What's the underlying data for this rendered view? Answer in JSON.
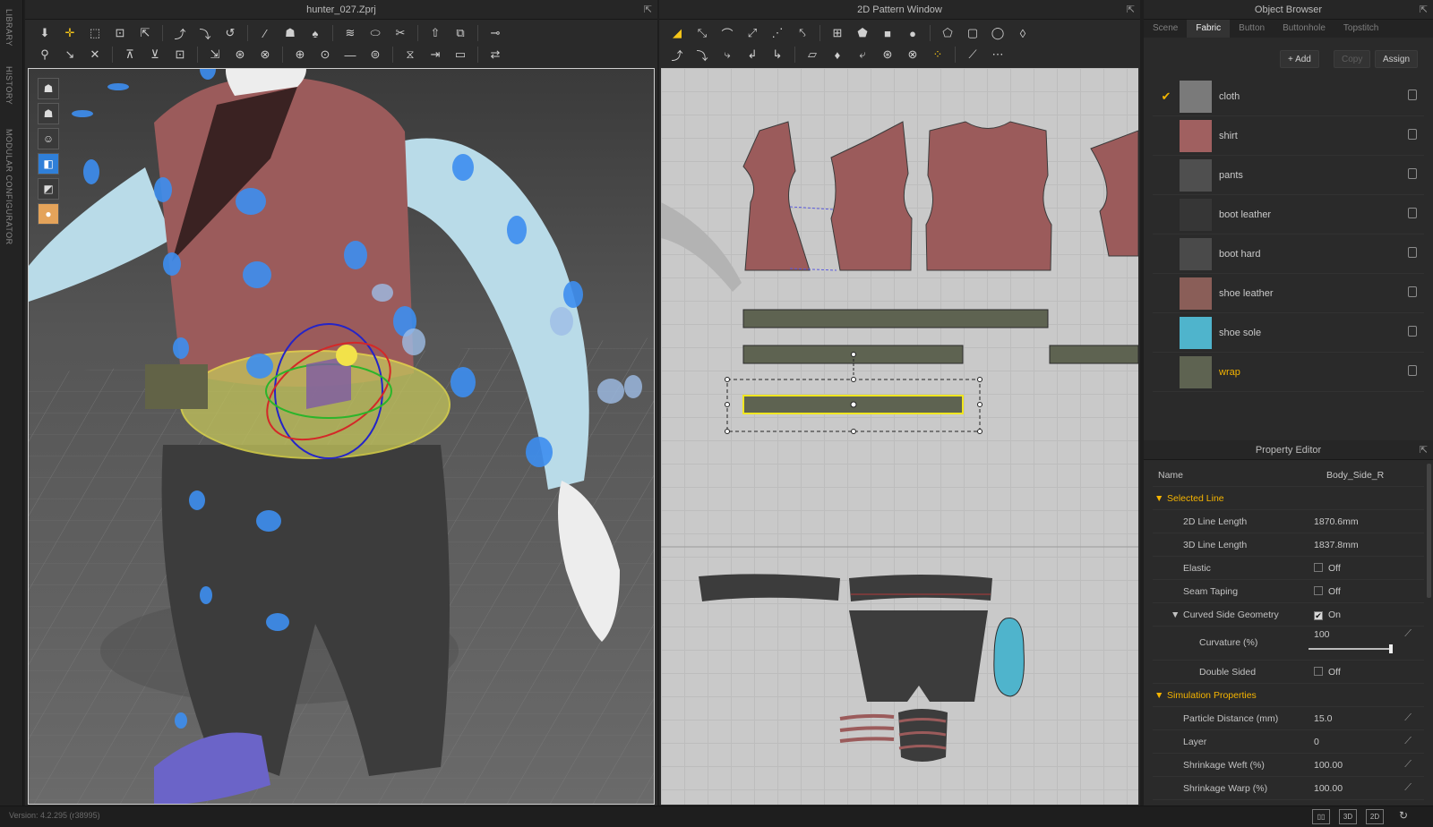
{
  "side_tabs": [
    "LIBRARY",
    "HISTORY",
    "MODULAR CONFIGURATOR"
  ],
  "viewport3d": {
    "title": "hunter_027.Zprj"
  },
  "pattern": {
    "title": "2D Pattern Window"
  },
  "object_browser": {
    "title": "Object Browser",
    "tabs": [
      "Scene",
      "Fabric",
      "Button",
      "Buttonhole",
      "Topstitch"
    ],
    "active_tab": "Fabric",
    "buttons": {
      "add": "+ Add",
      "copy": "Copy",
      "assign": "Assign"
    },
    "fabrics": [
      {
        "name": "cloth",
        "color": "#7a7a7a",
        "checked": true
      },
      {
        "name": "shirt",
        "color": "#a06060"
      },
      {
        "name": "pants",
        "color": "#4f4f4f"
      },
      {
        "name": "boot leather",
        "color": "#363636"
      },
      {
        "name": "boot hard",
        "color": "#4a4a4a"
      },
      {
        "name": "shoe leather",
        "color": "#8a5e58"
      },
      {
        "name": "shoe sole",
        "color": "#4fb4cc"
      },
      {
        "name": "wrap",
        "color": "#5e6351",
        "highlight": true
      }
    ]
  },
  "property_editor": {
    "title": "Property Editor",
    "name_label": "Name",
    "name_value": "Body_Side_R",
    "selected_line": "Selected Line",
    "line_2d_label": "2D Line Length",
    "line_2d_value": "1870.6mm",
    "line_3d_label": "3D Line Length",
    "line_3d_value": "1837.8mm",
    "elastic_label": "Elastic",
    "elastic_value": "Off",
    "seam_label": "Seam Taping",
    "seam_value": "Off",
    "curved_label": "Curved Side Geometry",
    "curved_value": "On",
    "curvature_label": "Curvature (%)",
    "curvature_value": "100",
    "double_label": "Double Sided",
    "double_value": "Off",
    "sim_props": "Simulation Properties",
    "particle_label": "Particle Distance (mm)",
    "particle_value": "15.0",
    "layer_label": "Layer",
    "layer_value": "0",
    "weft_label": "Shrinkage Weft (%)",
    "weft_value": "100.00",
    "warp_label": "Shrinkage Warp (%)",
    "warp_value": "100.00"
  },
  "status": {
    "version": "Version: 4.2.295 (r38995)",
    "view_3d": "3D",
    "view_2d": "2D"
  }
}
